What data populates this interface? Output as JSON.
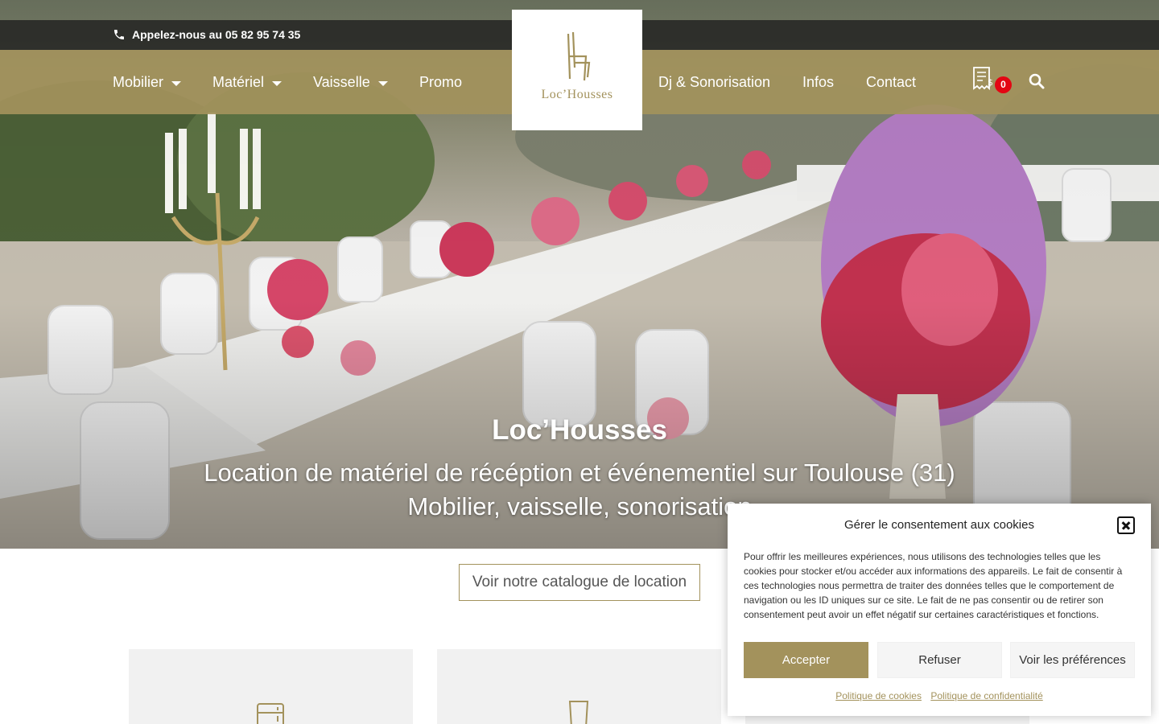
{
  "topbar": {
    "phone_text": "Appelez-nous au 05 82 95 74 35"
  },
  "nav": {
    "left_items": [
      {
        "label": "Mobilier",
        "has_dropdown": true
      },
      {
        "label": "Matériel",
        "has_dropdown": true
      },
      {
        "label": "Vaisselle",
        "has_dropdown": true
      },
      {
        "label": "Promo",
        "has_dropdown": false
      }
    ],
    "right_items": [
      {
        "label": "Dj & Sonorisation"
      },
      {
        "label": "Infos"
      },
      {
        "label": "Contact"
      }
    ],
    "cart_count": "0",
    "icons": {
      "cart": "cart-receipt-icon",
      "search": "search-icon",
      "phone": "phone-icon"
    }
  },
  "logo": {
    "brand": "Loc’Housses"
  },
  "hero": {
    "title": "Loc’Housses",
    "subtitle_line1": "Location de matériel de récéption et événementiel sur Toulouse (31)",
    "subtitle_line2": "Mobilier, vaisselle, sonorisation"
  },
  "catalog_button": "Voir notre catalogue de location",
  "cookie": {
    "title": "Gérer le consentement aux cookies",
    "text": "Pour offrir les meilleures expériences, nous utilisons des technologies telles que les cookies pour stocker et/ou accéder aux informations des appareils. Le fait de consentir à ces technologies nous permettra de traiter des données telles que le comportement de navigation ou les ID uniques sur ce site. Le fait de ne pas consentir ou de retirer son consentement peut avoir un effet négatif sur certaines caractéristiques et fonctions.",
    "accept": "Accepter",
    "refuse": "Refuser",
    "preferences": "Voir les préférences",
    "link_cookies": "Politique de cookies",
    "link_privacy": "Politique de confidentialité"
  },
  "colors": {
    "accent": "#a3925c",
    "badge": "#e30613",
    "topbar": "#1e1e1e"
  }
}
